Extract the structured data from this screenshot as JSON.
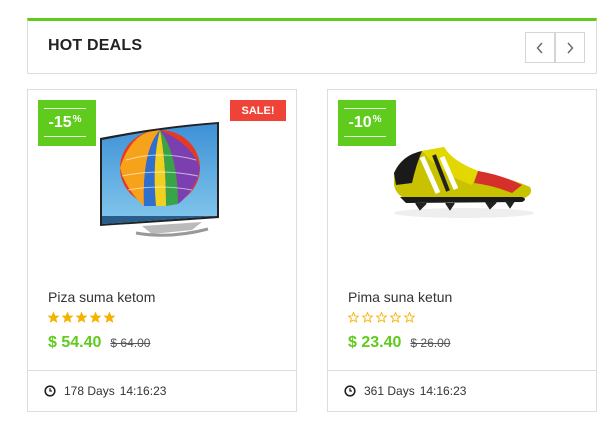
{
  "header": {
    "title": "HOT DEALS",
    "prev_icon": "chevron-left-icon",
    "next_icon": "chevron-right-icon"
  },
  "colors": {
    "accent": "#5fcb1d",
    "sale": "#f04338",
    "star": "#f5b301",
    "border": "#dddddd"
  },
  "products": [
    {
      "name": "Piza suma ketom",
      "discount_value": "-15",
      "discount_sign": "%",
      "sale_label": "SALE!",
      "rating": 5,
      "rating_max": 5,
      "price": "$ 54.40",
      "old_price": "$ 64.00",
      "countdown_days": "178 Days",
      "countdown_time": "14:16:23",
      "image_icon": "curved-tv-image"
    },
    {
      "name": "Pima suna ketun",
      "discount_value": "-10",
      "discount_sign": "%",
      "rating": 0,
      "rating_max": 5,
      "price": "$ 23.40",
      "old_price": "$ 26.00",
      "countdown_days": "361 Days",
      "countdown_time": "14:16:23",
      "image_icon": "football-boot-image"
    }
  ]
}
